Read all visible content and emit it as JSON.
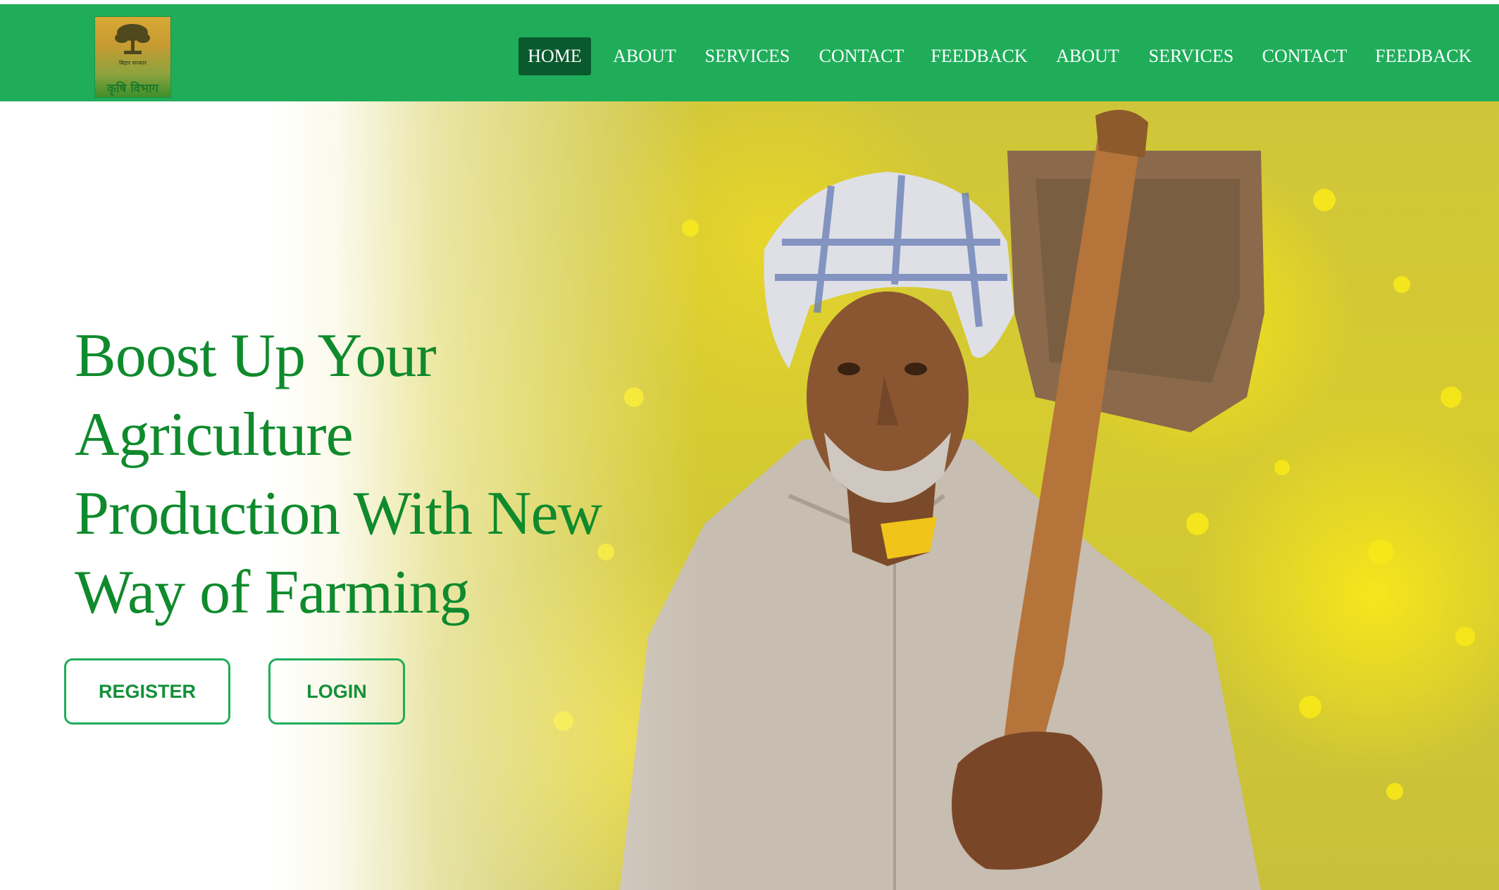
{
  "brand": {
    "logo_text": "कृषि विभाग",
    "logo_subtext": "बिहार सरकार"
  },
  "nav": {
    "items": [
      {
        "label": "HOME",
        "active": true
      },
      {
        "label": "ABOUT",
        "active": false
      },
      {
        "label": "SERVICES",
        "active": false
      },
      {
        "label": "CONTACT",
        "active": false
      },
      {
        "label": "FEEDBACK",
        "active": false
      },
      {
        "label": "ABOUT",
        "active": false
      },
      {
        "label": "SERVICES",
        "active": false
      },
      {
        "label": "CONTACT",
        "active": false
      },
      {
        "label": "FEEDBACK",
        "active": false
      }
    ]
  },
  "hero": {
    "headline": "Boost Up Your Agriculture Production With New Way of Farming",
    "image_subject": "farmer-with-spade-in-mustard-field",
    "register_label": "REGISTER",
    "login_label": "LOGIN"
  },
  "colors": {
    "nav_bg": "#1fad5a",
    "nav_active_bg": "#0a5a2f",
    "headline": "#0f8a2c",
    "button_border": "#1fad5a",
    "button_text": "#14903a"
  }
}
